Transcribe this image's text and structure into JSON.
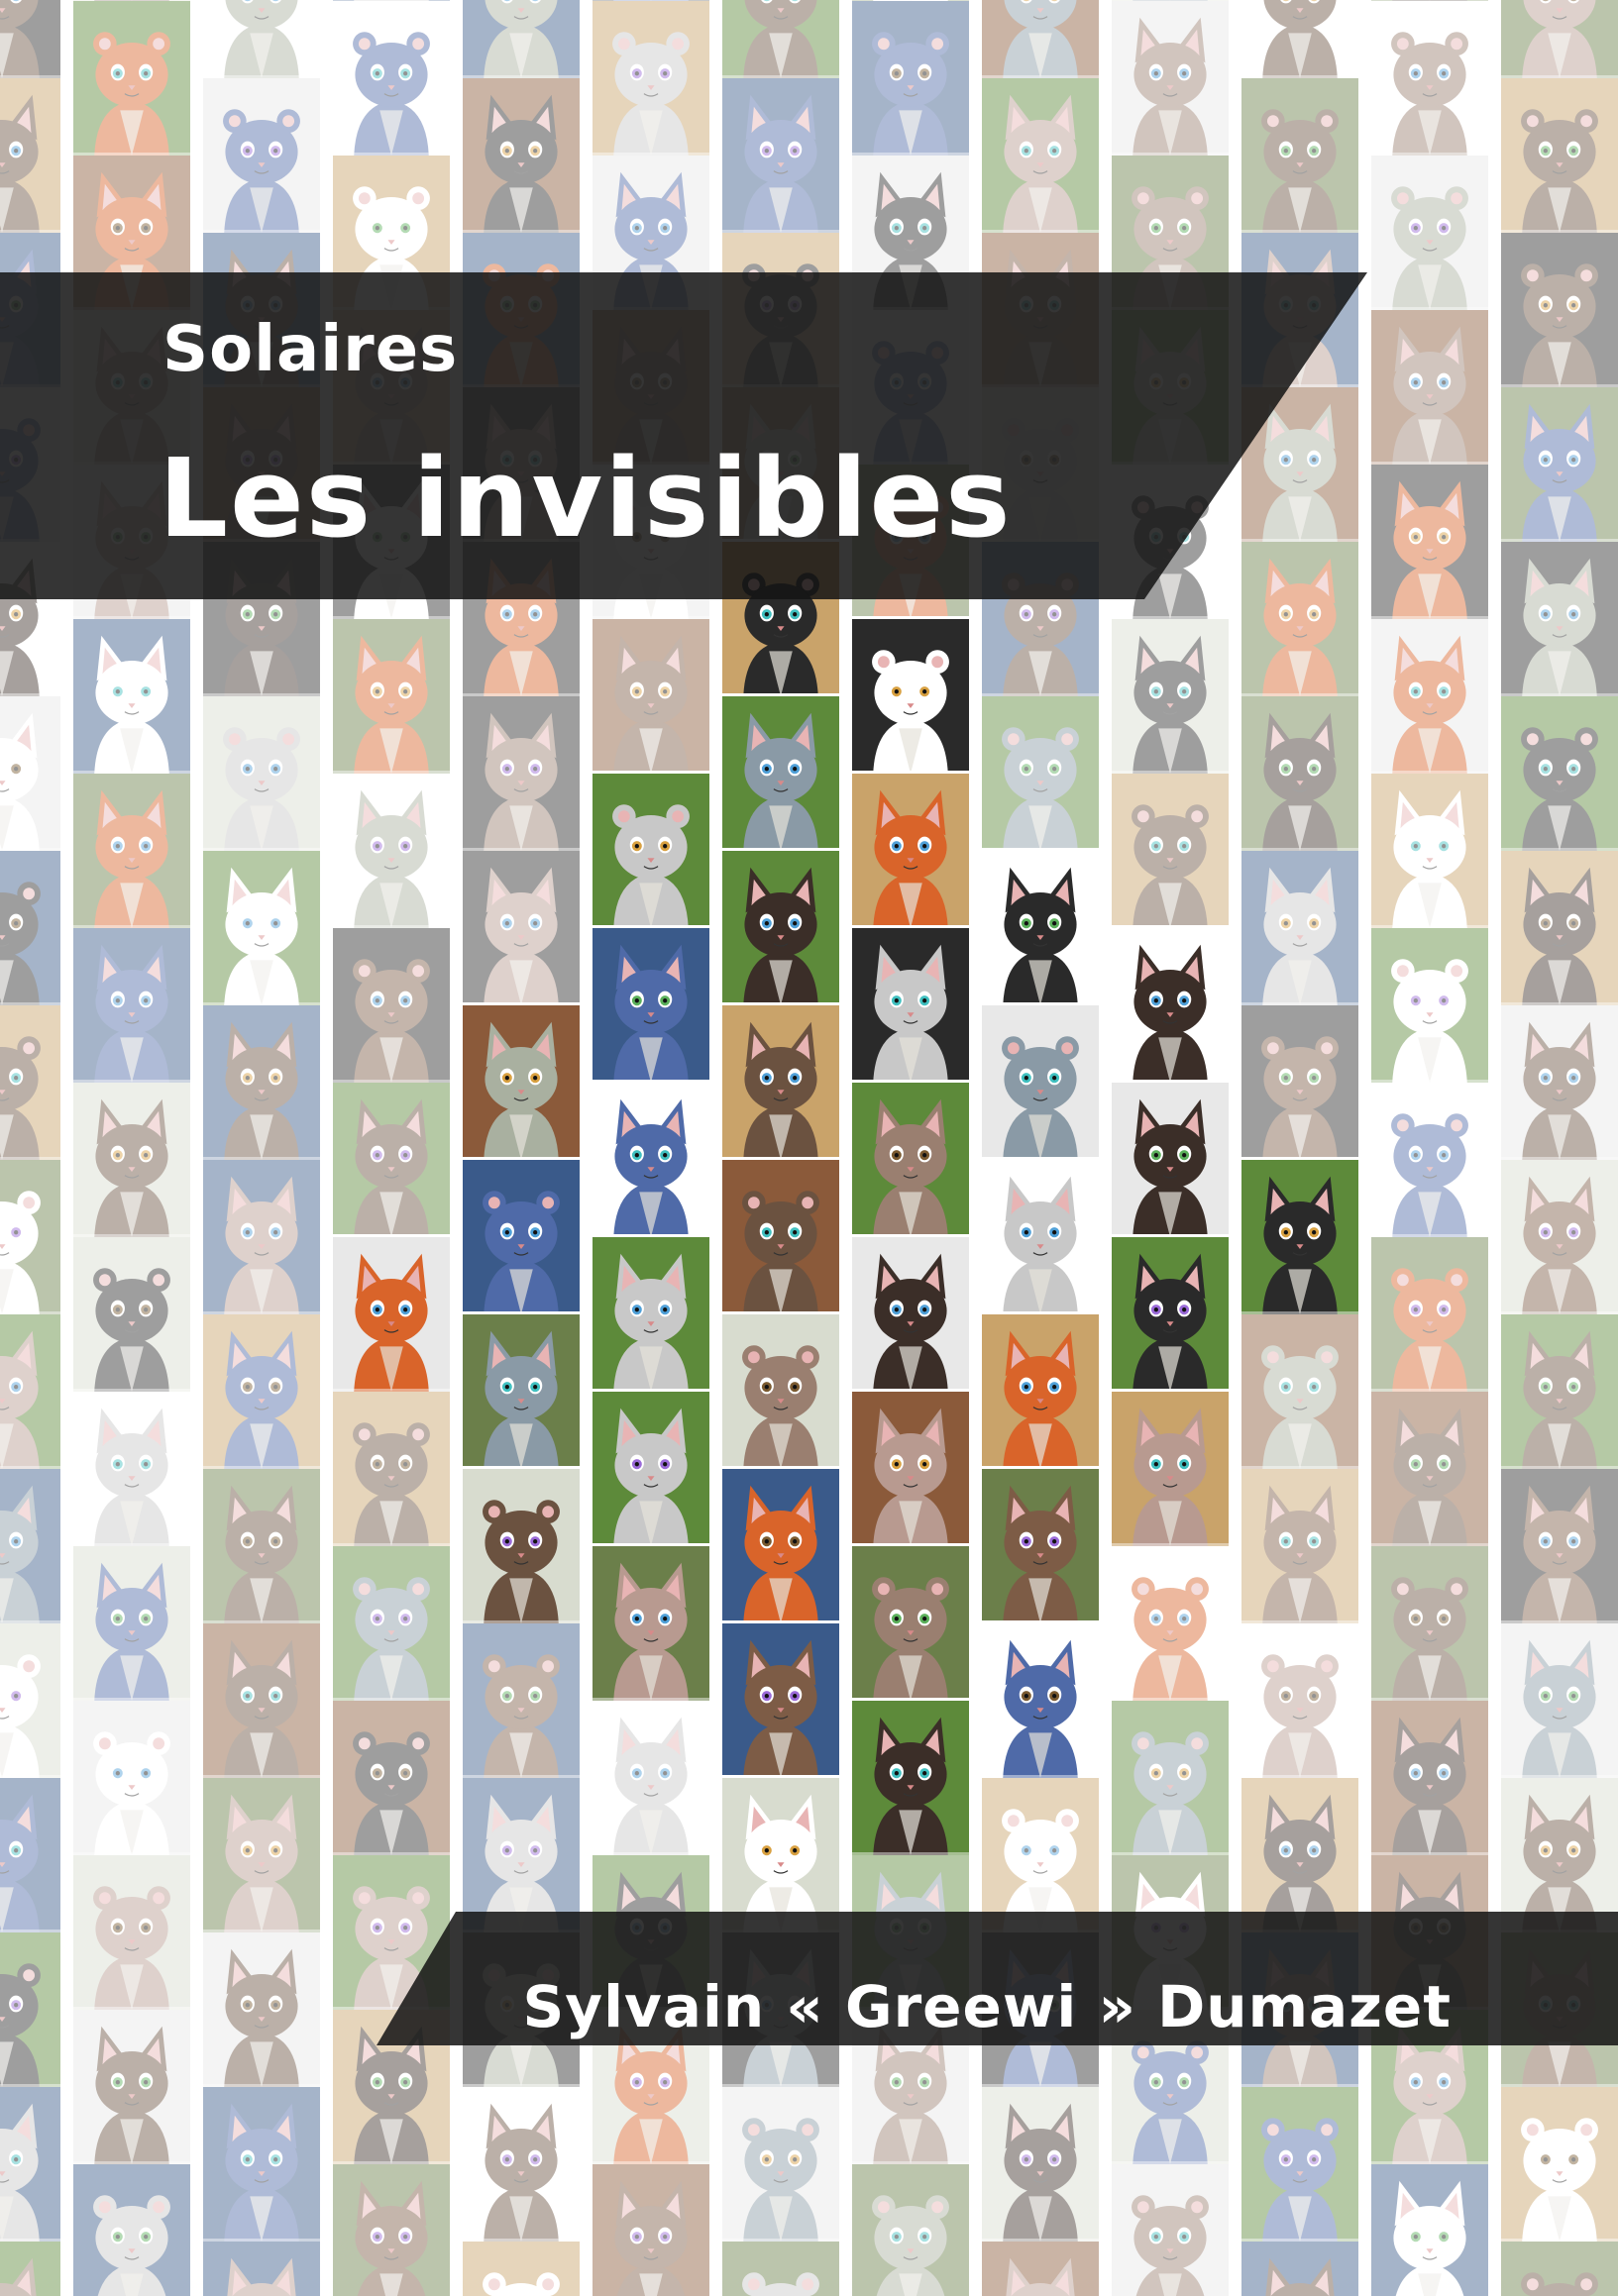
{
  "cover": {
    "series_title": "Solaires",
    "book_title": "Les invisibles",
    "author": "Sylvain « Greewi » Dumazet"
  },
  "background": {
    "description_icon": "cat-portrait-icon",
    "band_color": "#1a1a1a",
    "text_color": "#ffffff",
    "fur_colors": [
      "#c8c8c8",
      "#2a2a2a",
      "#ffffff",
      "#d9642a",
      "#8a9aa6",
      "#6b5240",
      "#b89a90",
      "#4f6aa8",
      "#3b2e28",
      "#a9b0a0",
      "#7d5c46",
      "#9a7f70"
    ],
    "backdrop_colors": [
      "#e8e8e8",
      "#ffffff",
      "#5d8a3a",
      "#3a5a8a",
      "#c9a36a",
      "#2a2a2a",
      "#8b5a3a",
      "#d8dccf",
      "#6b7f4a"
    ],
    "eye_colors": [
      "#4fa0d8",
      "#5bb05b",
      "#9a6ad8",
      "#d8a040",
      "#40c0c0",
      "#7a5a30"
    ]
  }
}
